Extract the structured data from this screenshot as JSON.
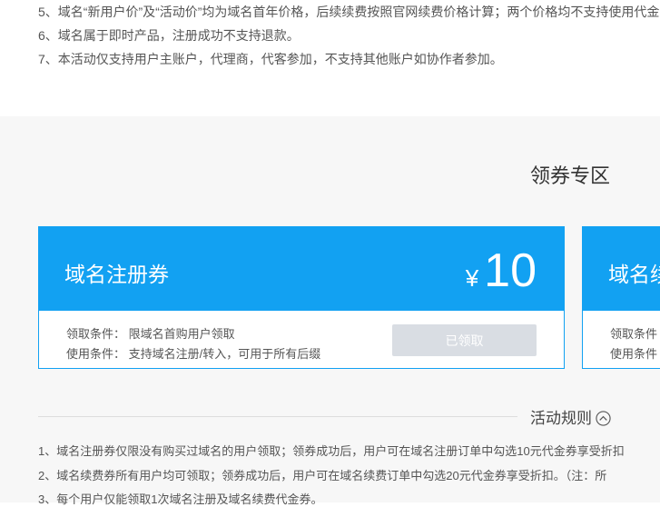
{
  "top_rules": [
    "5、域名“新用户价”及“活动价”均为域名首年价格，后续续费按照官网续费价格计算；两个价格均不支持使用代金",
    "6、域名属于即时产品，注册成功不支持退款。",
    "7、本活动仅支持用户主账户，代理商，代客参加，不支持其他账户如协作者参加。"
  ],
  "coupon_zone": {
    "title": "领券专区",
    "cards": [
      {
        "title": "域名注册券",
        "currency": "¥",
        "amount": "10",
        "condition_claim": "领取条件：  限域名首购用户领取",
        "condition_use": "使用条件：  支持域名注册/转入，可用于所有后缀",
        "button_label": "已领取"
      },
      {
        "title": "域名续",
        "condition_claim": "领取条件",
        "condition_use": "使用条件"
      }
    ]
  },
  "activity_rules": {
    "toggle_label": "活动规则",
    "items": [
      "1、域名注册券仅限没有购买过域名的用户领取；领券成功后，用户可在域名注册订单中勾选10元代金券享受折扣",
      "2、域名续费券所有用户均可领取；领券成功后，用户可在域名续费订单中勾选20元代金券享受折扣。（注：所",
      "3、每个用户仅能领取1次域名注册及域名续费代金券。"
    ]
  },
  "colors": {
    "accent": "#12a1f2",
    "disabled_button": "#d9dde3",
    "zone_bg": "#f7f7f7"
  }
}
